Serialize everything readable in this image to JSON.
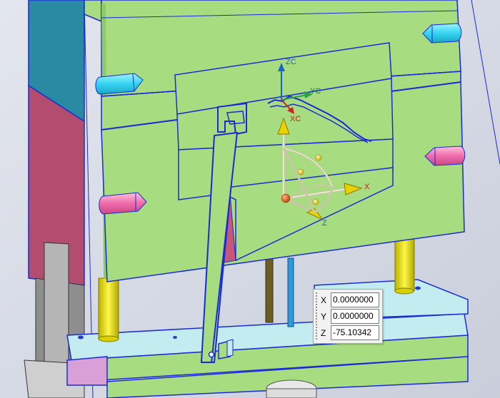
{
  "triad": {
    "zc_label": "ZC",
    "yc_label": "YC",
    "xc_label": "XC",
    "x_label": "X",
    "z_label": "Z"
  },
  "coordinate_panel": {
    "x_axis": "X",
    "x_value": "0.0000000",
    "y_axis": "Y",
    "y_value": "0.0000000",
    "z_axis": "Z",
    "z_value": "-75.10342"
  },
  "colors": {
    "plate_green": "#a8dc80",
    "edge_blue": "#1a2bd6",
    "plate_teal": "#24829c",
    "plate_magenta": "#b04a6e",
    "pin_yellow": "#e6e000",
    "lower_cyan": "#c2ecf0",
    "background": "#d7dbe6"
  }
}
